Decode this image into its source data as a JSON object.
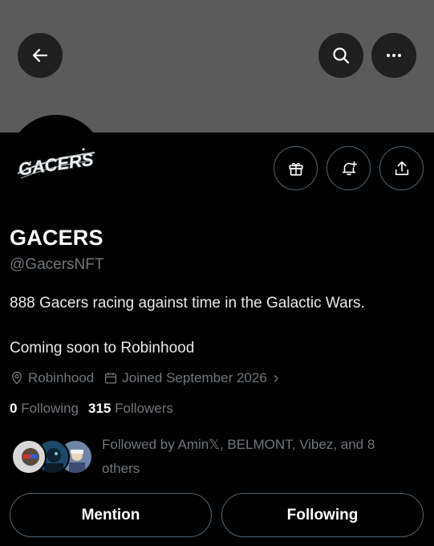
{
  "header": {
    "back_icon": "arrow-left-icon",
    "search_icon": "search-icon",
    "more_icon": "more-horizontal-icon"
  },
  "avatar": {
    "logo_text": "GACERS"
  },
  "actions": {
    "gift_icon": "gift-icon",
    "notify_icon": "bell-plus-icon",
    "share_icon": "share-upload-icon"
  },
  "profile": {
    "name": "GACERS",
    "handle": "@GacersNFT",
    "bio_line1": "888 Gacers racing against time in the Galactic Wars.",
    "bio_line2": "Coming soon to Robinhood",
    "location": "Robinhood",
    "joined": "Joined September 2026",
    "joined_chevron": "›",
    "following_count": "0",
    "following_label": "Following",
    "followers_count": "315",
    "followers_label": "Followers",
    "followed_by": "Followed by Amin𝕏, BELMONT, Vibez, and 8 others"
  },
  "buttons": {
    "mention": "Mention",
    "following": "Following"
  },
  "colors": {
    "background": "#000000",
    "banner": "#5b5b5b",
    "text_primary": "#e7e9ea",
    "text_secondary": "#71767b",
    "border": "#536471"
  }
}
